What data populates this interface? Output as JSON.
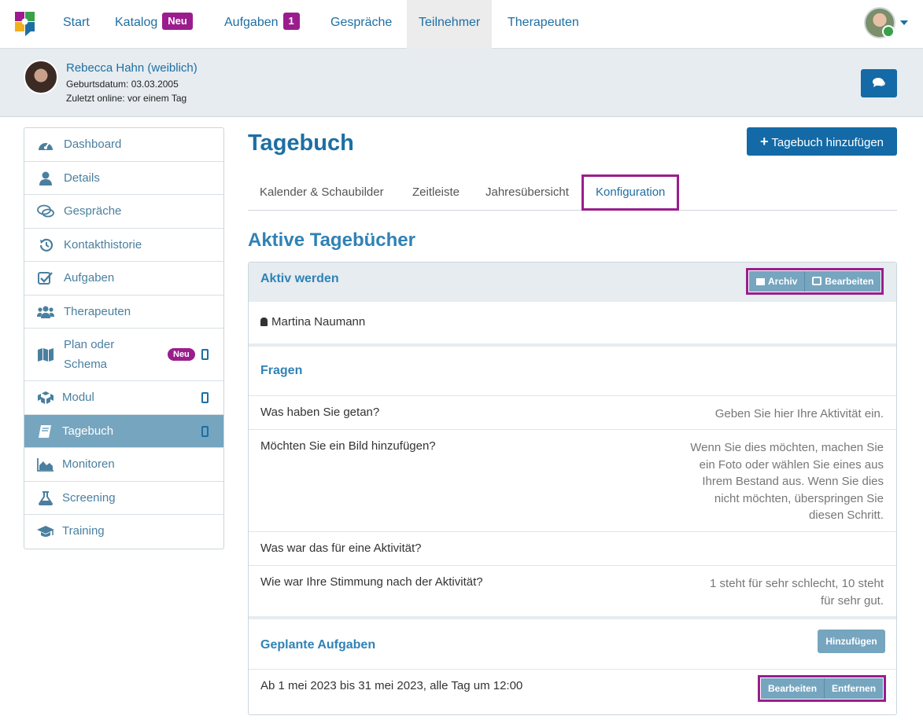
{
  "nav": {
    "items": [
      {
        "label": "Start"
      },
      {
        "label": "Katalog",
        "badge": "Neu"
      },
      {
        "label": "Aufgaben",
        "badge": "1"
      },
      {
        "label": "Gespräche"
      },
      {
        "label": "Teilnehmer",
        "active": true
      },
      {
        "label": "Therapeuten"
      }
    ]
  },
  "patient": {
    "name": "Rebecca Hahn (weiblich)",
    "birthdate": "Geburtsdatum: 03.03.2005",
    "last_online": "Zuletzt online: vor einem Tag"
  },
  "sidebar": {
    "items": [
      {
        "label": "Dashboard",
        "icon": "dashboard-icon"
      },
      {
        "label": "Details",
        "icon": "user-icon"
      },
      {
        "label": "Gespräche",
        "icon": "comments-icon"
      },
      {
        "label": "Kontakthistorie",
        "icon": "history-icon"
      },
      {
        "label": "Aufgaben",
        "icon": "checkbox-icon"
      },
      {
        "label": "Therapeuten",
        "icon": "users-icon"
      },
      {
        "label": "Plan oder Schema",
        "icon": "map-icon",
        "badge": "Neu",
        "mobile": true
      },
      {
        "label": "Modul",
        "icon": "cubes-icon",
        "mobile": true
      },
      {
        "label": "Tagebuch",
        "icon": "book-icon",
        "mobile": true,
        "active": true
      },
      {
        "label": "Monitoren",
        "icon": "area-chart-icon"
      },
      {
        "label": "Screening",
        "icon": "flask-icon"
      },
      {
        "label": "Training",
        "icon": "graduation-cap-icon"
      }
    ]
  },
  "main": {
    "title": "Tagebuch",
    "add_button": "Tagebuch hinzufügen",
    "tabs": [
      {
        "label": "Kalender & Schaubilder"
      },
      {
        "label": "Zeitleiste"
      },
      {
        "label": "Jahresübersicht"
      },
      {
        "label": "Konfiguration",
        "active": true
      }
    ],
    "section_title": "Aktive Tagebücher",
    "diary": {
      "title": "Aktiv werden",
      "archive_button": "Archiv",
      "edit_button": "Bearbeiten",
      "owner": "Martina Naumann",
      "questions_title": "Fragen",
      "questions": [
        {
          "q": "Was haben Sie getan?",
          "hint": "Geben Sie hier Ihre Aktivität ein."
        },
        {
          "q": "Möchten Sie ein Bild hinzufügen?",
          "hint": "Wenn Sie dies möchten, machen Sie ein Foto oder wählen Sie eines aus Ihrem Bestand aus. Wenn Sie dies nicht möchten, überspringen Sie diesen Schritt."
        },
        {
          "q": "Was war das für eine Aktivität?",
          "hint": ""
        },
        {
          "q": "Wie war Ihre Stimmung nach der Aktivität?",
          "hint": "1 steht für sehr schlecht, 10 steht für sehr gut."
        }
      ],
      "planned_title": "Geplante Aufgaben",
      "add_task_button": "Hinzufügen",
      "task": "Ab 1 mei 2023 bis 31 mei 2023, alle Tag um 12:00",
      "task_edit_button": "Bearbeiten",
      "task_remove_button": "Entfernen"
    }
  }
}
